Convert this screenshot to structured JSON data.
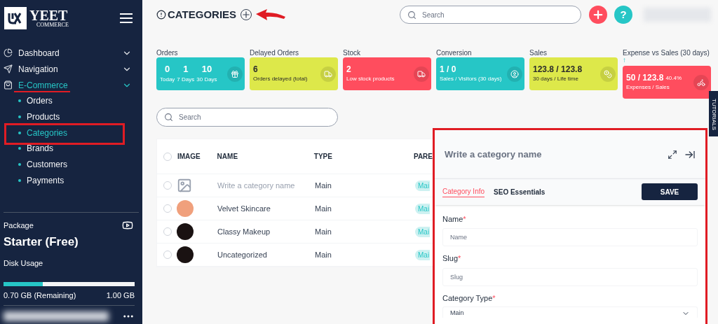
{
  "sidebar": {
    "logo": {
      "title": "YEET",
      "subtitle": "COMMERCE"
    },
    "items": [
      {
        "label": "Dashboard",
        "active": false,
        "expanded": false
      },
      {
        "label": "Navigation",
        "active": false,
        "expanded": false
      },
      {
        "label": "E-Commerce",
        "active": true,
        "expanded": true,
        "children": [
          {
            "label": "Orders",
            "selected": false
          },
          {
            "label": "Products",
            "selected": false
          },
          {
            "label": "Categories",
            "selected": true
          },
          {
            "label": "Brands",
            "selected": false
          },
          {
            "label": "Customers",
            "selected": false
          },
          {
            "label": "Payments",
            "selected": false
          }
        ]
      }
    ],
    "package": {
      "label": "Package",
      "plan": "Starter (Free)",
      "disk_label": "Disk Usage",
      "level": 0.3,
      "remaining": "0.70 GB (Remaining)",
      "total": "1.00 GB"
    }
  },
  "header": {
    "title": "CATEGORIES",
    "search_placeholder": "Search",
    "help": "?"
  },
  "stats": [
    {
      "title": "Orders",
      "kind": "multi",
      "color": "#26c6c6",
      "values": [
        {
          "value": "0",
          "caption": "Today"
        },
        {
          "value": "1",
          "caption": "7 Days"
        },
        {
          "value": "10",
          "caption": "30 Days"
        }
      ]
    },
    {
      "title": "Delayed Orders",
      "kind": "single",
      "color": "#dde84a",
      "value": "6",
      "caption": "Orders delayed (total)"
    },
    {
      "title": "Stock",
      "kind": "single",
      "color": "#ff4d5e",
      "value": "2",
      "caption": "Low stock products"
    },
    {
      "title": "Conversion",
      "kind": "single",
      "color": "#26c6c6",
      "value": "1 / 0",
      "caption": "Sales / Visitors (30 days)"
    },
    {
      "title": "Sales",
      "kind": "single",
      "color": "#dde84a",
      "value": "123.8 / 123.8",
      "caption": "30 days / Life time"
    },
    {
      "title": "Expense vs Sales (30 days)",
      "kind": "trend",
      "color": "#ff4d5e",
      "trend": "↑",
      "value": "50 / 123.8",
      "percent": "40.4%",
      "caption": "Expenses / Sales"
    }
  ],
  "search": {
    "placeholder": "Search"
  },
  "table": {
    "select_all_checked": false,
    "columns": [
      "IMAGE",
      "NAME",
      "TYPE",
      "PARE"
    ],
    "rows": [
      {
        "checked": false,
        "draft": true,
        "name": "Write a category name",
        "type": "Main",
        "parent": "Mai"
      },
      {
        "checked": false,
        "color": "#f0a07c",
        "draft": false,
        "name": "Velvet Skincare",
        "type": "Main",
        "parent": "Mai"
      },
      {
        "checked": false,
        "color": "#1a1212",
        "draft": false,
        "name": "Classy Makeup",
        "type": "Main",
        "parent": "Mai"
      },
      {
        "checked": false,
        "color": "#1a1212",
        "draft": false,
        "name": "Uncategorized",
        "type": "Main",
        "parent": "Mai"
      }
    ]
  },
  "panel": {
    "title_placeholder": "Write a category name",
    "tabs": [
      {
        "label": "Category Info",
        "selected": true
      },
      {
        "label": "SEO Essentials",
        "selected": false
      }
    ],
    "save": "SAVE",
    "required_mark": "*",
    "fields": [
      {
        "label": "Name",
        "required": true,
        "kind": "text",
        "placeholder": "Name"
      },
      {
        "label": "Slug",
        "required": true,
        "kind": "text",
        "placeholder": "Slug"
      },
      {
        "label": "Category Type",
        "required": true,
        "kind": "select",
        "value": "Main"
      }
    ]
  },
  "tutorials": "TUTORIALS"
}
